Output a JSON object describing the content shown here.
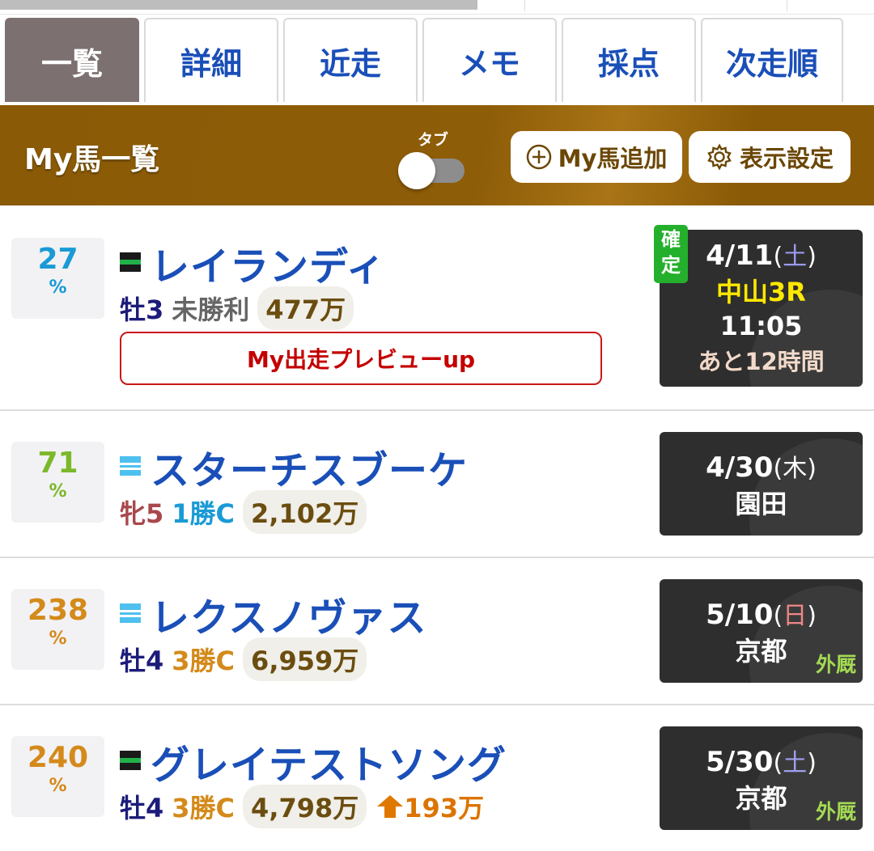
{
  "tabs": [
    {
      "label": "一覧",
      "active": true
    },
    {
      "label": "詳細",
      "active": false
    },
    {
      "label": "近走",
      "active": false
    },
    {
      "label": "メモ",
      "active": false
    },
    {
      "label": "採点",
      "active": false
    },
    {
      "label": "次走順",
      "active": false
    }
  ],
  "header": {
    "title": "My馬一覧",
    "toggle_label": "タブ",
    "toggle_on": false,
    "add_button": "My馬追加",
    "settings_button": "表示設定",
    "background_color": "#8a5a06"
  },
  "horses": [
    {
      "pct": "27",
      "pct_unit": "%",
      "pct_color": "#1a9ad6",
      "name": "レイランディ",
      "sex_age": "牡3",
      "sex_color": "#1c1c7a",
      "class": "未勝利",
      "class_color": "#666666",
      "prize": "477万",
      "preview_button": "My出走プレビューup",
      "confirmed_label": "確定",
      "race": {
        "date": "4/11",
        "weekday": "土",
        "weekday_color": "#9a9af0",
        "venue": "中山3R",
        "venue_color": "#ffe800",
        "time": "11:05",
        "remaining": "あと12時間"
      }
    },
    {
      "pct": "71",
      "pct_unit": "%",
      "pct_color": "#7cb82a",
      "name": "スターチスブーケ",
      "sex_age": "牝5",
      "sex_color": "#a8484c",
      "class": "1勝C",
      "class_color": "#1a9ad6",
      "prize": "2,102万",
      "race": {
        "date": "4/30",
        "weekday": "木",
        "weekday_color": "#ffffff",
        "venue": "園田"
      }
    },
    {
      "pct": "238",
      "pct_unit": "%",
      "pct_color": "#d48a1a",
      "name": "レクスノヴァス",
      "sex_age": "牡4",
      "sex_color": "#1c1c7a",
      "class": "3勝C",
      "class_color": "#d48a1a",
      "prize": "6,959万",
      "race": {
        "date": "5/10",
        "weekday": "日",
        "weekday_color": "#f08080",
        "venue": "京都",
        "outside": "外厩"
      }
    },
    {
      "pct": "240",
      "pct_unit": "%",
      "pct_color": "#d48a1a",
      "name": "グレイテストソング",
      "sex_age": "牡4",
      "sex_color": "#1c1c7a",
      "class": "3勝C",
      "class_color": "#d48a1a",
      "prize": "4,798万",
      "prize_up": "193万",
      "race": {
        "date": "5/30",
        "weekday": "土",
        "weekday_color": "#9a9af0",
        "venue": "京都",
        "outside": "外厩"
      }
    }
  ]
}
